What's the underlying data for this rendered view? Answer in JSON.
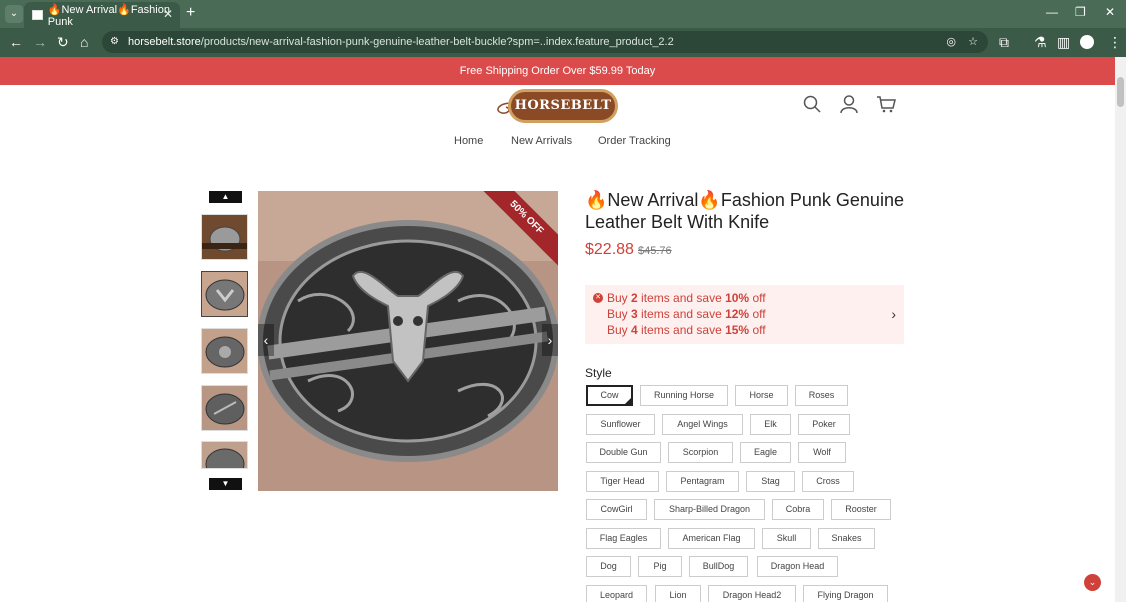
{
  "browser": {
    "tab_title": "🔥New Arrival🔥Fashion Punk",
    "url_host": "horsebelt.store",
    "url_path": "/products/new-arrival-fashion-punk-genuine-leather-belt-buckle?spm=..index.feature_product_2.2"
  },
  "promo": {
    "text": "Free Shipping Order Over $59.99 Today"
  },
  "header": {
    "logo_text": "HORSEBELT",
    "nav": [
      "Home",
      "New Arrivals",
      "Order Tracking"
    ]
  },
  "product": {
    "title": "🔥New Arrival🔥Fashion Punk Genuine Leather Belt With Knife",
    "price": "$22.88",
    "old_price": "$45.76",
    "badge": "50% OFF",
    "discounts": [
      {
        "pre": "Buy ",
        "qty": "2",
        "mid": " items and save ",
        "pct": "10%",
        "post": " off"
      },
      {
        "pre": "Buy ",
        "qty": "3",
        "mid": " items and save ",
        "pct": "12%",
        "post": " off"
      },
      {
        "pre": "Buy ",
        "qty": "4",
        "mid": " items and save ",
        "pct": "15%",
        "post": " off"
      }
    ],
    "style_label": "Style",
    "selected_style": "Cow",
    "styles": [
      "Cow",
      "Running Horse",
      "Horse",
      "Roses",
      "Sunflower",
      "Angel Wings",
      "Elk",
      "Poker",
      "Double Gun",
      "Scorpion",
      "Eagle",
      "Wolf",
      "Tiger Head",
      "Pentagram",
      "Stag",
      "Cross",
      "CowGirl",
      "Sharp-Billed Dragon",
      "Cobra",
      "Rooster",
      "Flag Eagles",
      "American Flag",
      "Skull",
      "Snakes",
      "Dog",
      "Pig",
      "BullDog",
      "Dragon Head",
      "Leopard",
      "Lion",
      "Dragon Head2",
      "Flying Dragon"
    ]
  },
  "colors": {
    "promo": "#dc4b4b",
    "price": "#d0413a",
    "browser": "#3c5a48"
  }
}
